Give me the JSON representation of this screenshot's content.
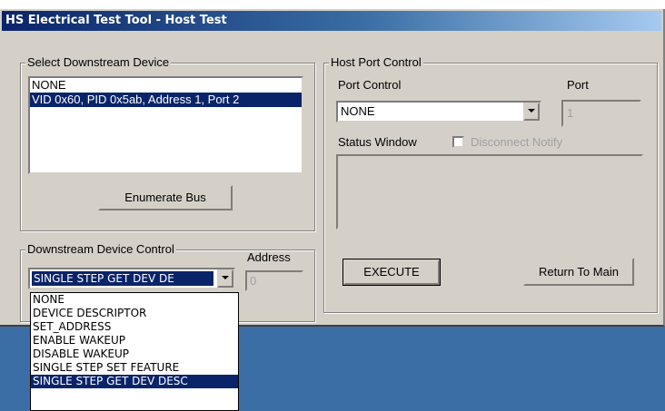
{
  "window": {
    "title": "HS Electrical Test Tool - Host Test"
  },
  "select_device": {
    "legend": "Select Downstream Device",
    "items": [
      "NONE",
      "VID 0x60, PID 0x5ab, Address 1, Port 2"
    ],
    "selected_index": 1,
    "enumerate_label": "Enumerate Bus"
  },
  "device_control": {
    "legend": "Downstream Device Control",
    "address_label": "Address",
    "address_value": "0",
    "combo_value": "SINGLE STEP GET DEV DE",
    "options": [
      "NONE",
      "DEVICE DESCRIPTOR",
      "SET_ADDRESS",
      "ENABLE WAKEUP",
      "DISABLE WAKEUP",
      "SINGLE STEP SET FEATURE",
      "SINGLE STEP GET DEV DESC"
    ],
    "selected_option_index": 6
  },
  "host_port": {
    "legend": "Host Port Control",
    "port_control_label": "Port Control",
    "port_control_value": "NONE",
    "port_label": "Port",
    "port_value": "1",
    "status_label": "Status Window",
    "disconnect_label": "Disconnect Notify",
    "execute_label": "EXECUTE",
    "return_label": "Return To Main"
  },
  "icons": [
    "chevron-down-icon",
    "checkbox"
  ],
  "colors": {
    "title_start": "#0a246a",
    "title_end": "#a6caf0",
    "selection": "#0a246a",
    "face": "#d4d0c8",
    "desktop": "#3a6ea5"
  }
}
